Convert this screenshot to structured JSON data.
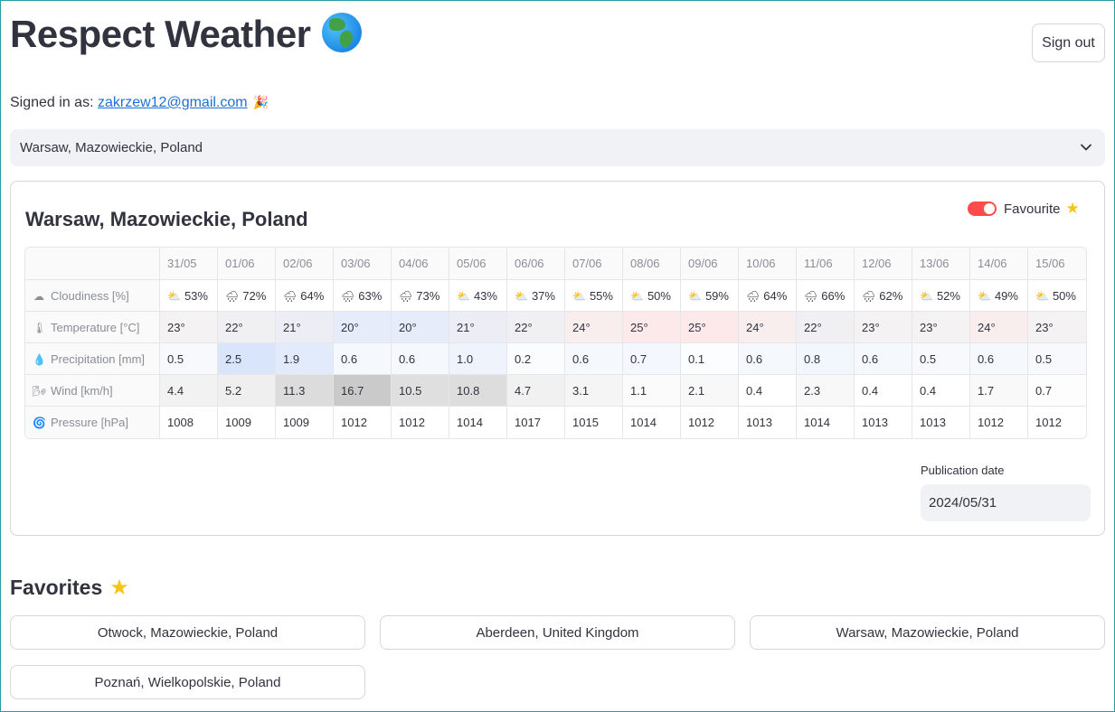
{
  "app": {
    "title": "Respect Weather",
    "title_icon": "globe-icon",
    "signout_label": "Sign out"
  },
  "signed_in": {
    "prefix": "Signed in as:",
    "email": "zakrzew12@gmail.com",
    "icon": "party-popper-icon"
  },
  "location_select": {
    "value": "Warsaw, Mazowieckie, Poland"
  },
  "forecast": {
    "title": "Warsaw, Mazowieckie, Poland",
    "favourite_label": "Favourite",
    "favourite_on": true,
    "dates": [
      "31/05",
      "01/06",
      "02/06",
      "03/06",
      "04/06",
      "05/06",
      "06/06",
      "07/06",
      "08/06",
      "09/06",
      "10/06",
      "11/06",
      "12/06",
      "13/06",
      "14/06",
      "15/06"
    ],
    "rows": [
      {
        "label": "Cloudiness [%]",
        "icon": "cloud-icon",
        "values": [
          "53%",
          "72%",
          "64%",
          "63%",
          "73%",
          "43%",
          "37%",
          "55%",
          "50%",
          "59%",
          "64%",
          "66%",
          "62%",
          "52%",
          "49%",
          "50%"
        ],
        "icons": [
          "sun-behind-cloud-icon",
          "rain-cloud-icon",
          "rain-cloud-icon",
          "rain-cloud-icon",
          "rain-cloud-icon",
          "sun-behind-cloud-icon",
          "sun-behind-cloud-icon",
          "sun-behind-cloud-icon",
          "sun-behind-cloud-icon",
          "sun-behind-cloud-icon",
          "rain-cloud-icon",
          "rain-cloud-icon",
          "rain-cloud-icon",
          "sun-behind-cloud-icon",
          "sun-behind-cloud-icon",
          "sun-behind-cloud-icon"
        ],
        "bg": [
          "#ffffff",
          "#ffffff",
          "#ffffff",
          "#ffffff",
          "#ffffff",
          "#ffffff",
          "#ffffff",
          "#ffffff",
          "#ffffff",
          "#ffffff",
          "#ffffff",
          "#ffffff",
          "#ffffff",
          "#ffffff",
          "#ffffff",
          "#ffffff"
        ]
      },
      {
        "label": "Temperature [°C]",
        "icon": "thermometer-icon",
        "values": [
          "23°",
          "22°",
          "21°",
          "20°",
          "20°",
          "21°",
          "22°",
          "24°",
          "25°",
          "25°",
          "24°",
          "22°",
          "23°",
          "23°",
          "24°",
          "23°"
        ],
        "bg": [
          "#f4f2f3",
          "#f0f0f3",
          "#ecedf5",
          "#e6ecfa",
          "#e6ecfa",
          "#ecedf5",
          "#f0f0f3",
          "#f9eeee",
          "#fde8ea",
          "#fde8ea",
          "#f9eeee",
          "#f0f0f3",
          "#f4f2f3",
          "#f4f2f3",
          "#f9eeee",
          "#f4f2f3"
        ]
      },
      {
        "label": "Precipitation [mm]",
        "icon": "droplet-icon",
        "values": [
          "0.5",
          "2.5",
          "1.9",
          "0.6",
          "0.6",
          "1.0",
          "0.2",
          "0.6",
          "0.7",
          "0.1",
          "0.6",
          "0.8",
          "0.6",
          "0.5",
          "0.6",
          "0.5"
        ],
        "bg": [
          "#f7f9fd",
          "#d9e5fb",
          "#e2ebfb",
          "#f5f8fd",
          "#f5f8fd",
          "#eff3fc",
          "#fbfcfe",
          "#f5f8fd",
          "#f4f7fd",
          "#fcfdfe",
          "#f5f8fd",
          "#f2f6fd",
          "#f5f8fd",
          "#f7f9fd",
          "#f5f8fd",
          "#f7f9fd"
        ]
      },
      {
        "label": "Wind [km/h]",
        "icon": "wind-icon",
        "values": [
          "4.4",
          "5.2",
          "11.3",
          "16.7",
          "10.5",
          "10.8",
          "4.7",
          "3.1",
          "1.1",
          "2.1",
          "0.4",
          "2.3",
          "0.4",
          "0.4",
          "1.7",
          "0.7"
        ],
        "bg": [
          "#f2f2f2",
          "#efefef",
          "#dcdcdc",
          "#cacaca",
          "#dfdfdf",
          "#dddddd",
          "#f1f1f1",
          "#f5f5f5",
          "#fbfbfb",
          "#f8f8f8",
          "#ffffff",
          "#f8f8f8",
          "#ffffff",
          "#ffffff",
          "#f9f9f9",
          "#fdfdfd"
        ]
      },
      {
        "label": "Pressure [hPa]",
        "icon": "cyclone-icon",
        "values": [
          "1008",
          "1009",
          "1009",
          "1012",
          "1012",
          "1014",
          "1017",
          "1015",
          "1014",
          "1012",
          "1013",
          "1014",
          "1013",
          "1013",
          "1012",
          "1012"
        ],
        "bg": [
          "#ffffff",
          "#ffffff",
          "#ffffff",
          "#ffffff",
          "#ffffff",
          "#ffffff",
          "#ffffff",
          "#ffffff",
          "#ffffff",
          "#ffffff",
          "#ffffff",
          "#ffffff",
          "#ffffff",
          "#ffffff",
          "#ffffff",
          "#ffffff"
        ]
      }
    ],
    "publication_label": "Publication date",
    "publication_value": "2024/05/31"
  },
  "favorites": {
    "heading": "Favorites",
    "heading_icon": "star-icon",
    "items": [
      "Otwock, Mazowieckie, Poland",
      "Aberdeen, United Kingdom",
      "Warsaw, Mazowieckie, Poland",
      "Poznań, Wielkopolskie, Poland"
    ]
  }
}
